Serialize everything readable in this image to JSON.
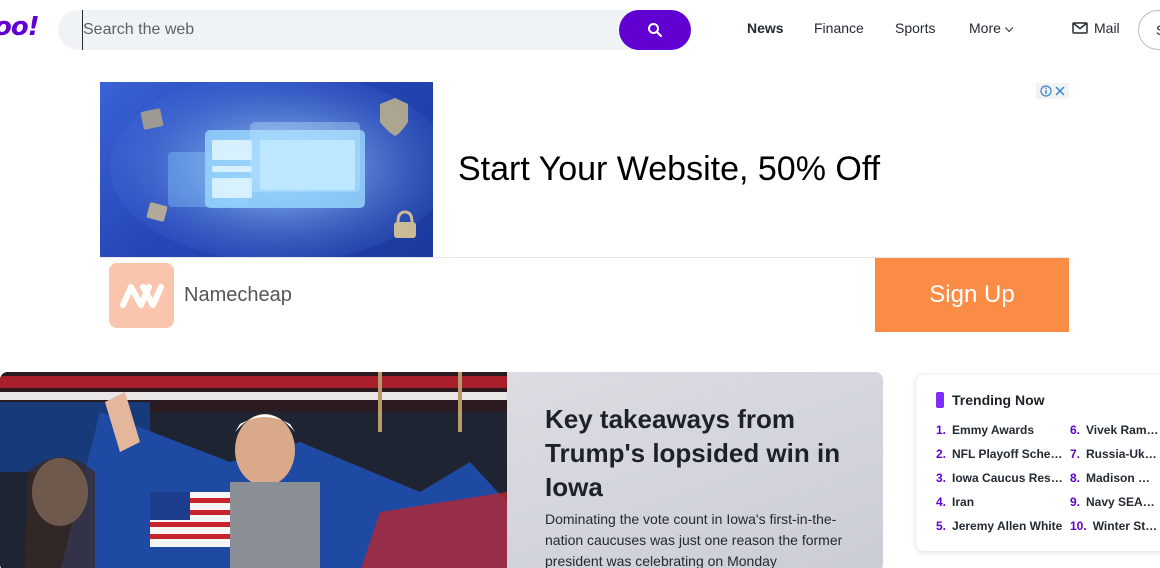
{
  "header": {
    "logo": "oo!",
    "search_placeholder": "Search the web",
    "nav": [
      "News",
      "Finance",
      "Sports",
      "More"
    ],
    "mail": "Mail",
    "signin": "S"
  },
  "ad": {
    "headline": "Start Your Website, 50% Off",
    "brand": "Namecheap",
    "cta": "Sign Up"
  },
  "hero": {
    "title": "Key takeaways from Trump's lopsided win in Iowa",
    "summary": "Dominating the vote count in Iowa's first-in-the-nation caucuses was just one reason the former president was celebrating on Monday"
  },
  "trending": {
    "title": "Trending Now",
    "items": [
      {
        "num": "1.",
        "label": "Emmy Awards"
      },
      {
        "num": "2.",
        "label": "NFL Playoff Schedule"
      },
      {
        "num": "3.",
        "label": "Iowa Caucus Results"
      },
      {
        "num": "4.",
        "label": "Iran"
      },
      {
        "num": "5.",
        "label": "Jeremy Allen White"
      },
      {
        "num": "6.",
        "label": "Vivek Ramaswamy"
      },
      {
        "num": "7.",
        "label": "Russia-Ukraine"
      },
      {
        "num": "8.",
        "label": "Madison Marsh"
      },
      {
        "num": "9.",
        "label": "Navy SEALs M"
      },
      {
        "num": "10.",
        "label": "Winter Storm"
      }
    ]
  },
  "colors": {
    "brand": "#6001d2",
    "cta": "#fb8c45",
    "trend_accent": "#7d2eff"
  }
}
